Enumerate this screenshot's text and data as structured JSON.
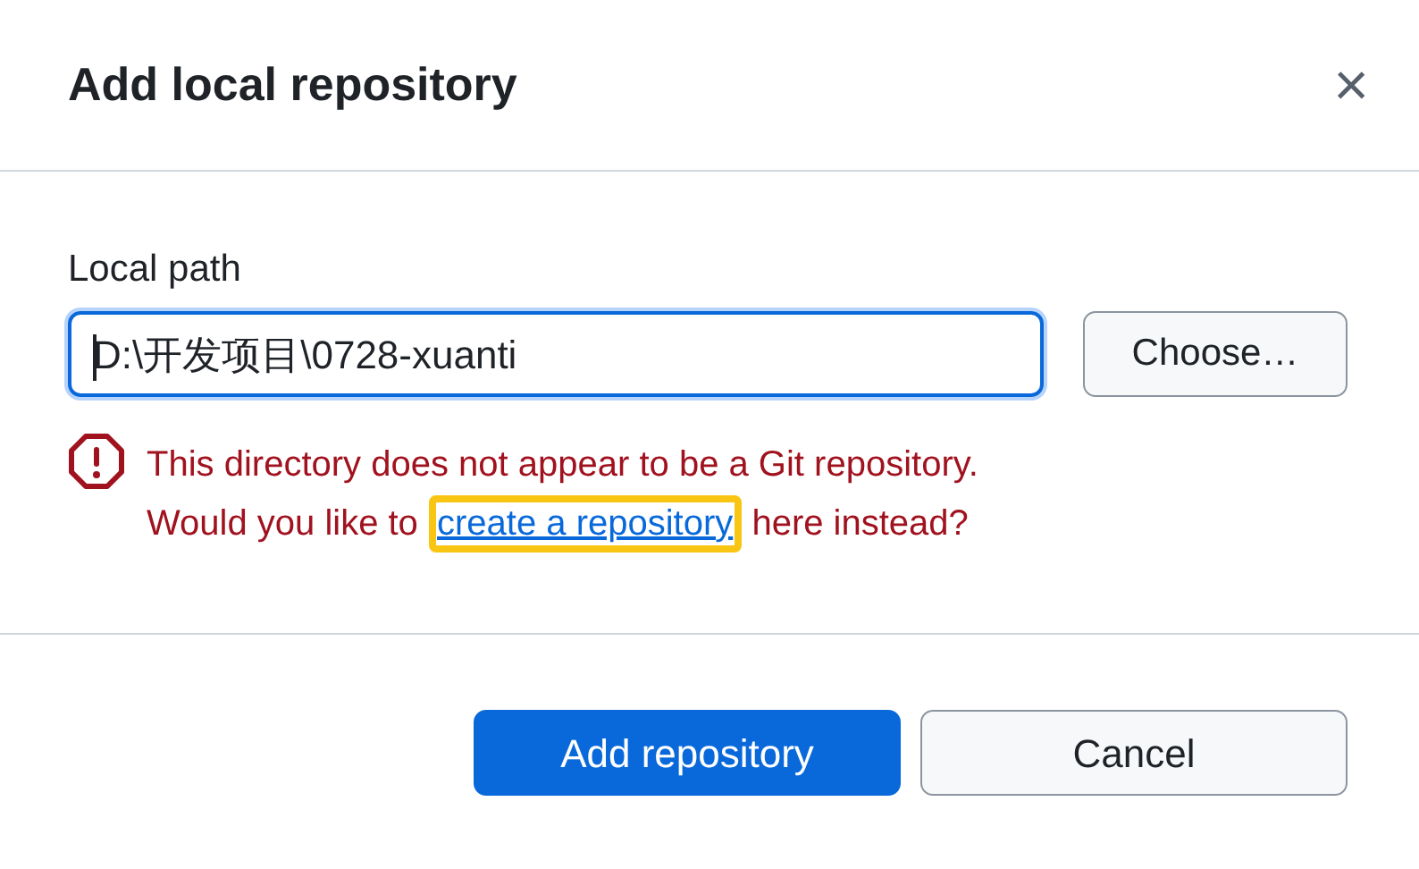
{
  "dialog": {
    "title": "Add local repository",
    "close": "×"
  },
  "field": {
    "label": "Local path",
    "value": "D:\\开发项目\\0728-xuanti",
    "focused": true
  },
  "choose_button": "Choose…",
  "error": {
    "line_1": "This directory does not appear to be a Git repository.",
    "line_2_before": "Would you like to",
    "link": {
      "text": "create a repository",
      "highlighted": true
    },
    "line_2_after": "here instead?"
  },
  "buttons": [
    {
      "label": "Add repository",
      "kind": "primary"
    },
    {
      "label": "Cancel",
      "kind": "secondary"
    }
  ]
}
